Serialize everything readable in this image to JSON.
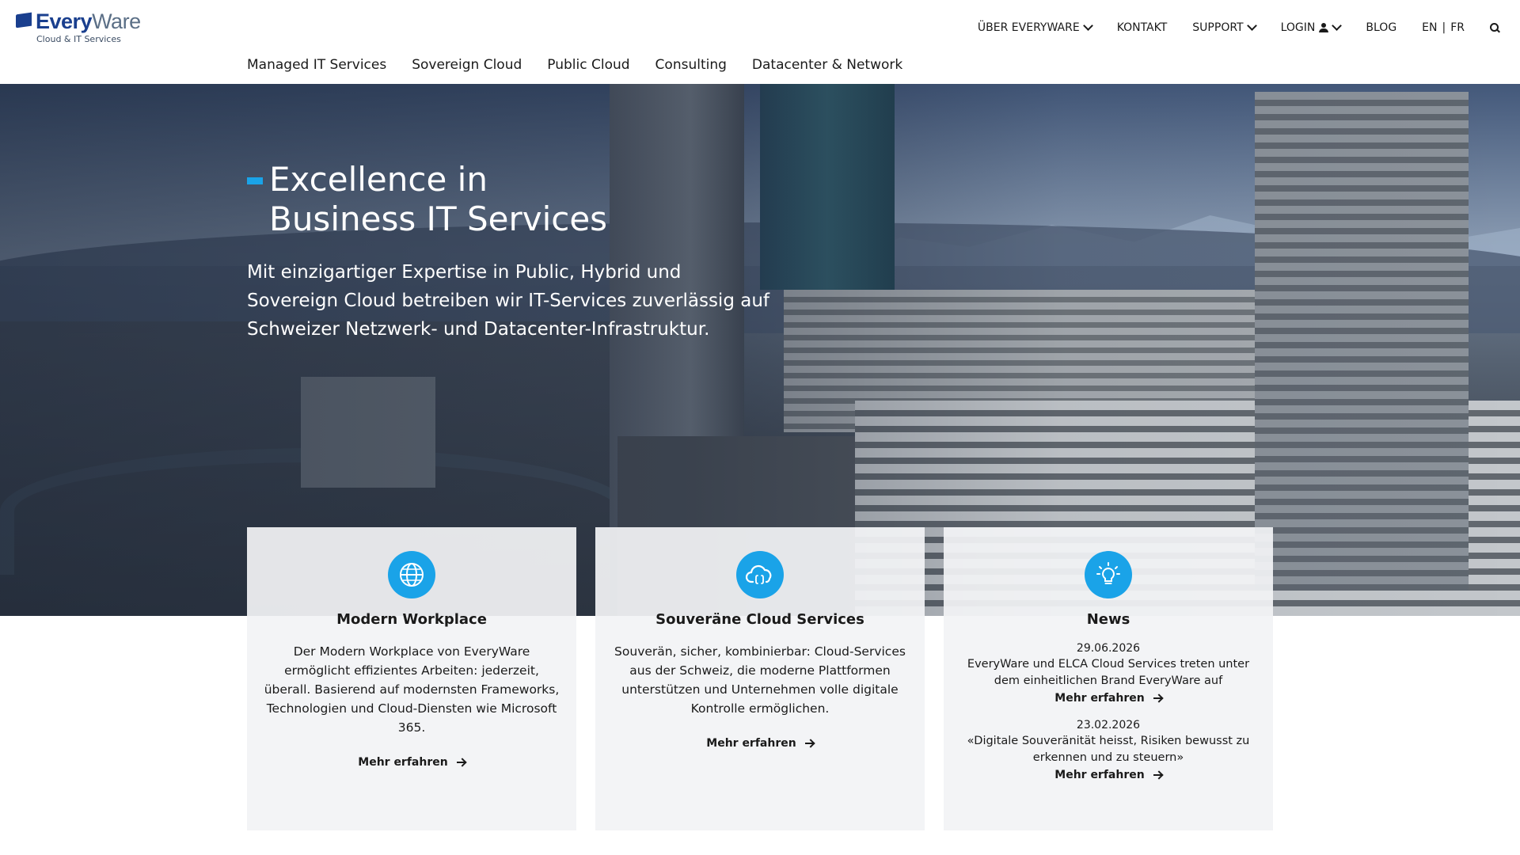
{
  "brand": {
    "name_bold": "Every",
    "name_light": "Ware",
    "tagline": "Cloud & IT Services",
    "accent_color": "#1aa3e8",
    "logo_color": "#1a3f8e"
  },
  "topnav": {
    "items": [
      {
        "label": "ÜBER EVERYWARE",
        "icon": "chevron-down-icon"
      },
      {
        "label": "KONTAKT"
      },
      {
        "label": "SUPPORT",
        "icon": "chevron-down-icon"
      },
      {
        "label": "LOGIN",
        "icon": "person-icon"
      }
    ],
    "blog": "BLOG",
    "lang": {
      "en": "EN",
      "sep": "|",
      "fr": "FR"
    },
    "search_icon": "search-icon"
  },
  "mainnav": {
    "items": [
      "Managed IT Services",
      "Sovereign Cloud",
      "Public Cloud",
      "Consulting",
      "Datacenter & Network"
    ]
  },
  "hero": {
    "title_line1": "Excellence in",
    "title_line2": "Business IT Services",
    "text": "Mit einzigartiger Expertise in Public, Hybrid und Sovereign Cloud betreiben wir IT-Services zuverlässig auf Schweizer Netzwerk- und Datacenter-Infrastruktur."
  },
  "cards": [
    {
      "icon": "globe-icon",
      "title": "Modern Workplace",
      "text": "Der Modern Workplace von EveryWare ermöglicht effizientes Arbeiten: jederzeit, überall. Basierend auf modernsten Frameworks, Technologien und Cloud-Diensten wie Microsoft 365.",
      "link": "Mehr erfahren"
    },
    {
      "icon": "cloud-code-icon",
      "title": "Souveräne Cloud Services",
      "text": "Souverän, sicher, kombinierbar: Cloud-Services aus der Schweiz, die moderne Plattformen unterstützen und Unternehmen volle digitale Kontrolle ermöglichen.",
      "link": "Mehr erfahren"
    },
    {
      "icon": "lightbulb-icon",
      "title": "News",
      "news": [
        {
          "date": "29.06.2026",
          "text": "EveryWare und ELCA Cloud Services treten unter dem einheitlichen Brand EveryWare auf",
          "link": "Mehr erfahren"
        },
        {
          "date": "23.02.2026",
          "text": "«Digitale Souveränität heisst, Risiken bewusst zu erkennen und zu steuern»",
          "link": "Mehr erfahren"
        }
      ]
    }
  ]
}
